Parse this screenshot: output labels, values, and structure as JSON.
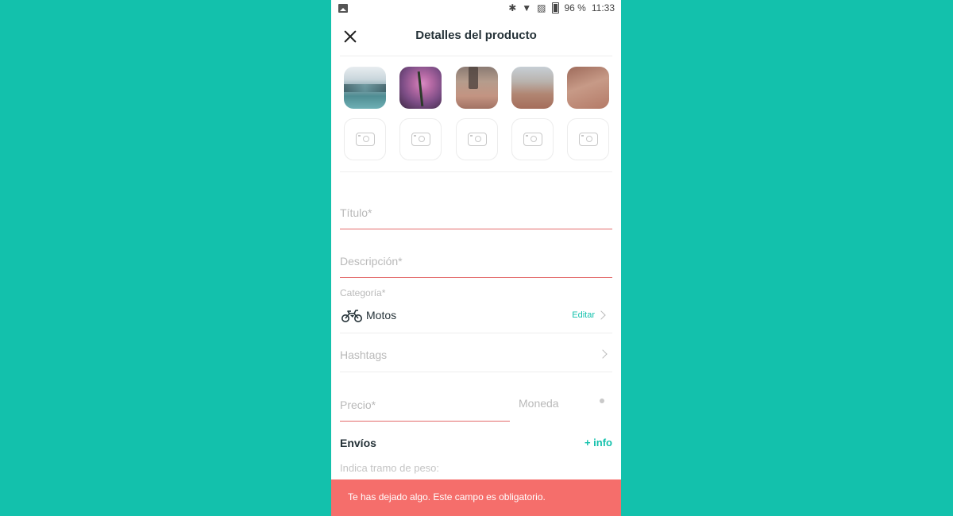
{
  "status_bar": {
    "battery": "96 %",
    "time": "11:33",
    "icons": [
      "image-notification-icon",
      "bluetooth-icon",
      "wifi-icon",
      "no-sim-icon",
      "battery-icon"
    ]
  },
  "header": {
    "title": "Detalles del producto",
    "close_icon": "close-icon"
  },
  "photos": {
    "filled": 5,
    "empty_slots": 5,
    "placeholder_icon": "camera-icon"
  },
  "form": {
    "title_placeholder": "Título*",
    "description_placeholder": "Descripción*",
    "category_label": "Categoría*",
    "category_value": "Motos",
    "category_icon": "motorcycle-icon",
    "category_edit": "Editar",
    "hashtags_placeholder": "Hashtags",
    "price_placeholder": "Precio*",
    "currency_placeholder": "Moneda"
  },
  "shipping": {
    "title": "Envíos",
    "info_link": "+ info",
    "weight_hint": "Indica tramo de peso:"
  },
  "toast": {
    "message": "Te has dejado algo. Este campo es obligatorio."
  },
  "colors": {
    "background": "#13c1ac",
    "accent": "#13c1ac",
    "error": "#e36b6b",
    "toast": "#f56e6b"
  }
}
